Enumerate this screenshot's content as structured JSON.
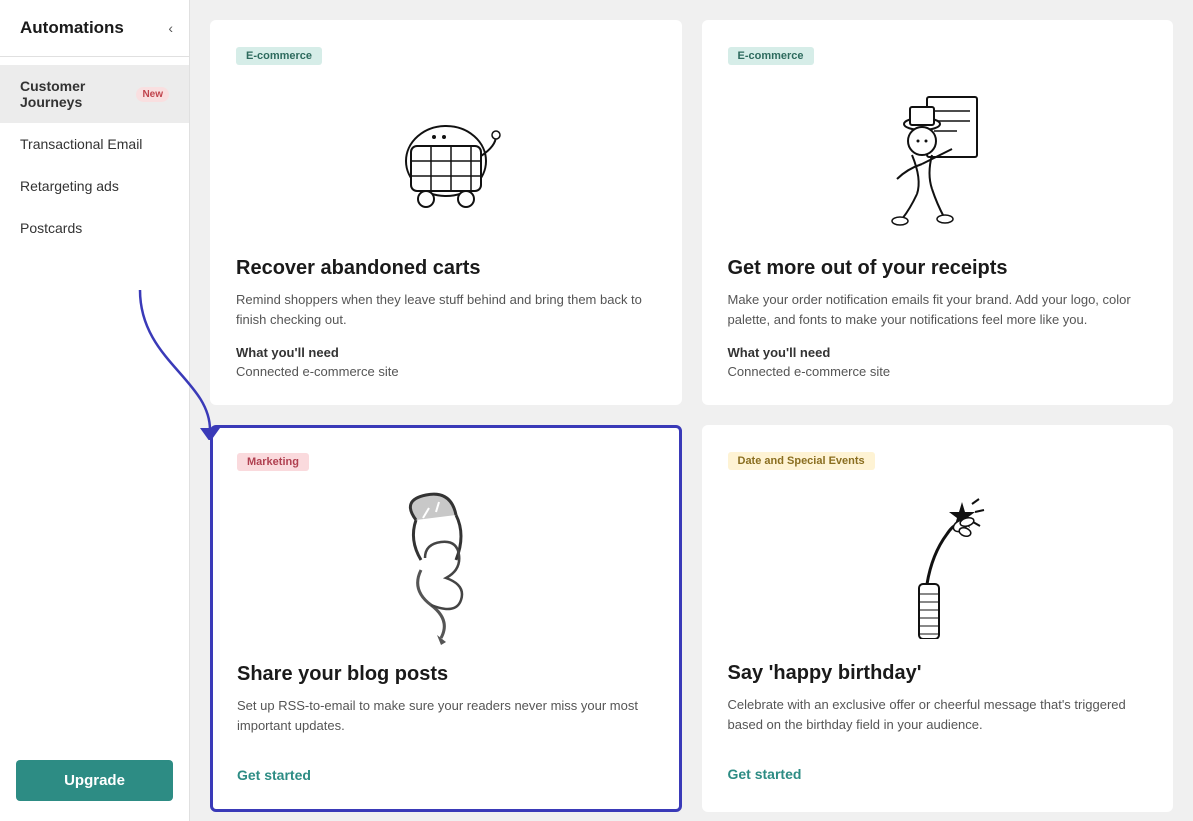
{
  "sidebar": {
    "title": "Automations",
    "collapse_icon": "‹",
    "items": [
      {
        "id": "customer-journeys",
        "label": "Customer Journeys",
        "badge": "New",
        "active": true
      },
      {
        "id": "transactional-email",
        "label": "Transactional Email",
        "badge": null,
        "active": false
      },
      {
        "id": "retargeting-ads",
        "label": "Retargeting ads",
        "badge": null,
        "active": false
      },
      {
        "id": "postcards",
        "label": "Postcards",
        "badge": null,
        "active": false
      }
    ],
    "upgrade_button": "Upgrade"
  },
  "cards": [
    {
      "id": "recover-abandoned-carts",
      "badge": "E-commerce",
      "badge_type": "ecommerce",
      "title": "Recover abandoned carts",
      "description": "Remind shoppers when they leave stuff behind and bring them back to finish checking out.",
      "need_label": "What you'll need",
      "need_value": "Connected e-commerce site",
      "link": null,
      "highlighted": false,
      "illustration": "cart"
    },
    {
      "id": "get-more-receipts",
      "badge": "E-commerce",
      "badge_type": "ecommerce",
      "title": "Get more out of your receipts",
      "description": "Make your order notification emails fit your brand. Add your logo, color palette, and fonts to make your notifications feel more like you.",
      "need_label": "What you'll need",
      "need_value": "Connected e-commerce site",
      "link": null,
      "highlighted": false,
      "illustration": "receipt"
    },
    {
      "id": "share-blog-posts",
      "badge": "Marketing",
      "badge_type": "marketing",
      "title": "Share your blog posts",
      "description": "Set up RSS-to-email to make sure your readers never miss your most important updates.",
      "need_label": null,
      "need_value": null,
      "link": "Get started",
      "highlighted": true,
      "illustration": "magnet"
    },
    {
      "id": "say-happy-birthday",
      "badge": "Date and Special Events",
      "badge_type": "date",
      "title": "Say 'happy birthday'",
      "description": "Celebrate with an exclusive offer or cheerful message that's triggered based on the birthday field in your audience.",
      "need_label": null,
      "need_value": null,
      "link": "Get started",
      "highlighted": false,
      "illustration": "birthday"
    }
  ]
}
